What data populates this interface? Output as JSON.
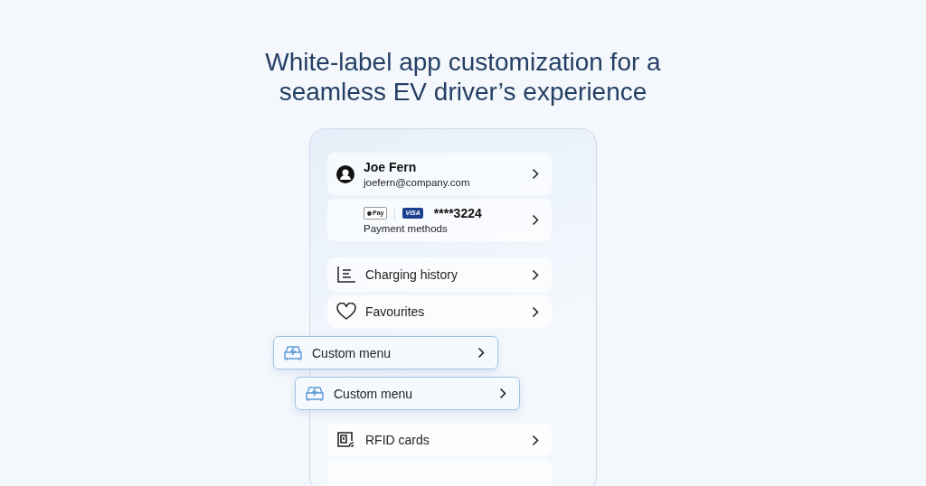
{
  "heading": "White-label app customization for a seamless EV driver’s experience",
  "profile": {
    "name": "Joe Fern",
    "email": "joefern@company.com"
  },
  "payment": {
    "badges": [
      {
        "kind": "applepay",
        "text": "Pay"
      },
      {
        "kind": "visa",
        "text": "VISA"
      }
    ],
    "card": "****3224",
    "label": "Payment methods"
  },
  "menu": [
    {
      "kind": "history",
      "label": "Charging history"
    },
    {
      "kind": "heart",
      "label": "Favourites"
    }
  ],
  "custom_menus": [
    {
      "label": "Custom menu"
    },
    {
      "label": "Custom menu"
    }
  ],
  "menu_lower": [
    {
      "kind": "rfid",
      "label": "RFID cards"
    }
  ]
}
